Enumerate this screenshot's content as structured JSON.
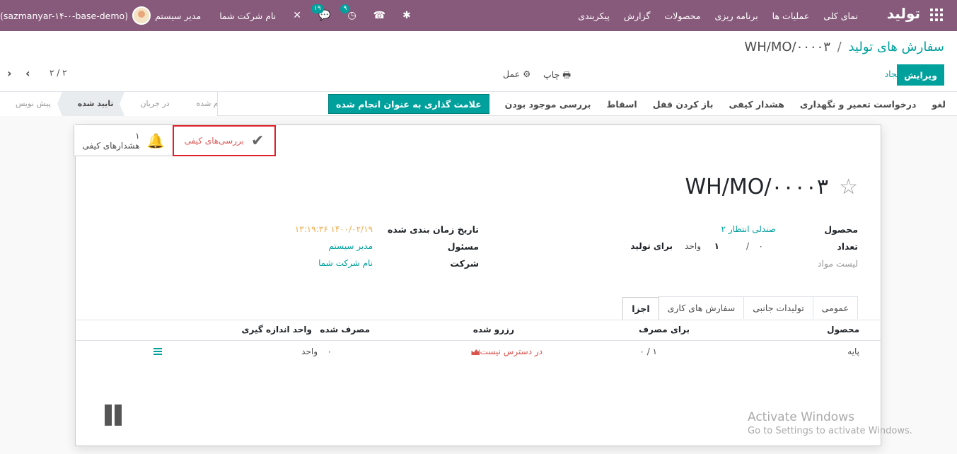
{
  "navbar": {
    "brand": "تولید",
    "menu": [
      "نمای کلی",
      "عملیات ها",
      "برنامه ریزی",
      "محصولات",
      "گزارش",
      "پیکربندی"
    ],
    "company": "نام شرکت شما",
    "user": "مدیر سیستم",
    "database": "(sazmanyar-۱۴-۰-base-demo)",
    "activity_badge": "۹",
    "messages_badge": "۱۹",
    "icons": [
      "apps-icon",
      "debug-icon",
      "phone-icon",
      "clock-icon",
      "chat-icon",
      "tools-icon"
    ]
  },
  "breadcrumb": {
    "parent": "سفارش های تولید",
    "separator": "/",
    "current": "WH/MO/۰۰۰۰۳"
  },
  "control_panel": {
    "edit_label": "ویرایش",
    "create_label": "ایجاد",
    "print_label": "چاپ",
    "action_label": "عمل",
    "pager": "۲ / ۲"
  },
  "statusbar": {
    "buttons": [
      "علامت گذاری به عنوان انجام شده",
      "بررسی موجود بودن",
      "اسقاط",
      "باز کردن قفل",
      "هشدار کیفی",
      "درخواست تعمیر و نگهداری",
      "لغو"
    ],
    "stages": [
      "پیش نویس",
      "تایید شده",
      "در جریان",
      "انجام شده"
    ],
    "active_stage": "تایید شده"
  },
  "smart_buttons": {
    "quality_alerts": {
      "count": "۱",
      "label": "هشدارهای کیفی"
    },
    "quality_checks": {
      "label": "بررسی‌های کیفی"
    }
  },
  "record": {
    "title": "WH/MO/۰۰۰۰۳",
    "fields_right": {
      "product_label": "محصول",
      "product_value": "صندلی انتظار ۲",
      "qty_label": "تعداد",
      "qty_done": "۰",
      "qty_sep": "/",
      "qty_total": "۱",
      "qty_uom": "واحد",
      "qty_suffix": "برای تولید",
      "bom_label": "لیست مواد"
    },
    "fields_left": {
      "date_label": "تاریخ زمان بندی شده",
      "date_value": "۱۴۰۰/۰۲/۱۹ ۱۳:۱۹:۳۶",
      "responsible_label": "مسئول",
      "responsible_value": "مدیر سیستم",
      "company_label": "شرکت",
      "company_value": "نام شرکت شما"
    }
  },
  "tabs": [
    "اجزا",
    "سفارش های کاری",
    "تولیدات جانبی",
    "عمومی"
  ],
  "components_table": {
    "headers": [
      "محصول",
      "برای مصرف",
      "رزرو شده",
      "مصرف شده",
      "واحد اندازه گیری"
    ],
    "rows": [
      {
        "product": "پایه",
        "to_consume": "۱ / ۰",
        "reserved": "در دسترس نیست",
        "consumed": "۰",
        "uom": "واحد"
      }
    ]
  },
  "watermark": {
    "line1": "Activate Windows",
    "line2": "Go to Settings to activate Windows."
  },
  "colors": {
    "navbar": "#875a7b",
    "primary": "#00a09d",
    "danger": "#d9534f",
    "highlight_border": "#e0202a",
    "date": "#f0ad4e"
  }
}
